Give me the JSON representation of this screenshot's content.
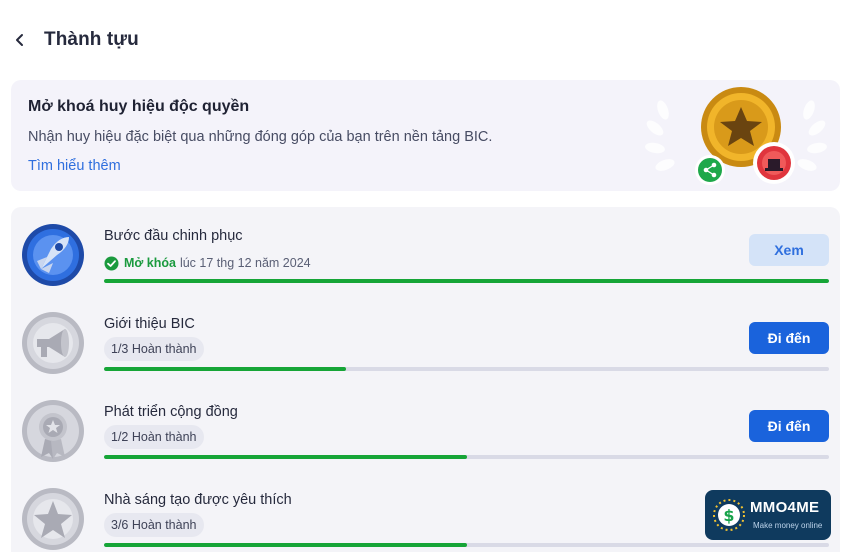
{
  "header": {
    "back_icon": "chevron-left-icon",
    "title": "Thành tựu"
  },
  "banner": {
    "title": "Mở khoá huy hiệu độc quyền",
    "description": "Nhận huy hiệu đặc biệt qua những đóng góp của bạn trên nền tảng BIC.",
    "link": "Tìm hiểu thêm"
  },
  "achievements": [
    {
      "title": "Bước đầu chinh phục",
      "icon": "rocket-badge-icon",
      "status_label": "Mở khóa",
      "status_time": "lúc 17 thg 12 năm 2024",
      "progress_fraction": 1.0,
      "button": "Xem"
    },
    {
      "title": "Giới thiệu BIC",
      "icon": "megaphone-badge-icon",
      "progress_text": "1/3 Hoàn thành",
      "progress_fraction": 0.3333,
      "button": "Đi đến"
    },
    {
      "title": "Phát triển cộng đồng",
      "icon": "medal-badge-icon",
      "progress_text": "1/2 Hoàn thành",
      "progress_fraction": 0.5,
      "button": "Đi đến"
    },
    {
      "title": "Nhà sáng tạo được yêu thích",
      "icon": "star-badge-icon",
      "progress_text": "3/6 Hoàn thành",
      "progress_fraction": 0.5
    }
  ],
  "watermark": {
    "name": "MMO4ME",
    "tagline": "Make money online"
  },
  "colors": {
    "primary": "#1a63dc",
    "success": "#16a537",
    "link": "#2f6fde"
  }
}
